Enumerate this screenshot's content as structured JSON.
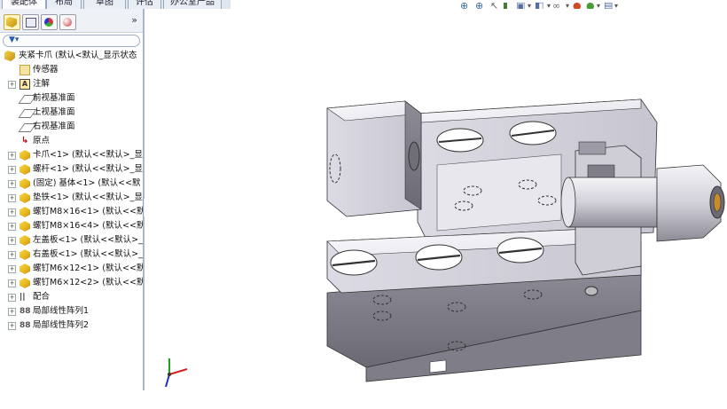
{
  "command_tabs": [
    "装配体",
    "布局",
    "草图",
    "评估",
    "办公室产品"
  ],
  "feature_tree": {
    "root": "夹紧卡爪 (默认<默认_显示状态",
    "items": [
      {
        "label": "传感器",
        "icon": "sensor-icon",
        "expandable": false
      },
      {
        "label": "注解",
        "icon": "annotation-icon",
        "expandable": true
      },
      {
        "label": "前视基准面",
        "icon": "plane-icon",
        "expandable": false
      },
      {
        "label": "上视基准面",
        "icon": "plane-icon",
        "expandable": false
      },
      {
        "label": "右视基准面",
        "icon": "plane-icon",
        "expandable": false
      },
      {
        "label": "原点",
        "icon": "origin-icon",
        "expandable": false
      },
      {
        "label": "卡爪<1> (默认<<默认>_显",
        "icon": "part-icon",
        "expandable": true
      },
      {
        "label": "螺杆<1> (默认<<默认>_显",
        "icon": "part-icon",
        "expandable": true
      },
      {
        "label": "(固定) 基体<1> (默认<<默",
        "icon": "part-icon",
        "expandable": true
      },
      {
        "label": "垫铁<1> (默认<<默认>_显",
        "icon": "part-icon",
        "expandable": true
      },
      {
        "label": "螺钉M8×16<1> (默认<<默",
        "icon": "part-icon",
        "expandable": true
      },
      {
        "label": "螺钉M8×16<4> (默认<<默",
        "icon": "part-icon",
        "expandable": true
      },
      {
        "label": "左盖板<1> (默认<<默认>_",
        "icon": "part-icon",
        "expandable": true
      },
      {
        "label": "右盖板<1> (默认<<默认>_",
        "icon": "part-icon",
        "expandable": true
      },
      {
        "label": "螺钉M6×12<1> (默认<<默",
        "icon": "part-icon",
        "expandable": true
      },
      {
        "label": "螺钉M6×12<2> (默认<<默",
        "icon": "part-icon",
        "expandable": true
      },
      {
        "label": "配合",
        "icon": "mate-icon",
        "expandable": true
      },
      {
        "label": "局部线性阵列1",
        "icon": "pattern-icon",
        "expandable": true
      },
      {
        "label": "局部线性阵列2",
        "icon": "pattern-icon",
        "expandable": true
      }
    ]
  },
  "colors": {
    "panel_border": "#aab7c8",
    "part_face_light": "#f2f2f6",
    "part_face_mid": "#d9d8e2",
    "part_face_dark": "#6f6e78",
    "axis_x": "#d22020",
    "axis_y": "#20a020",
    "axis_z": "#2030d0"
  }
}
